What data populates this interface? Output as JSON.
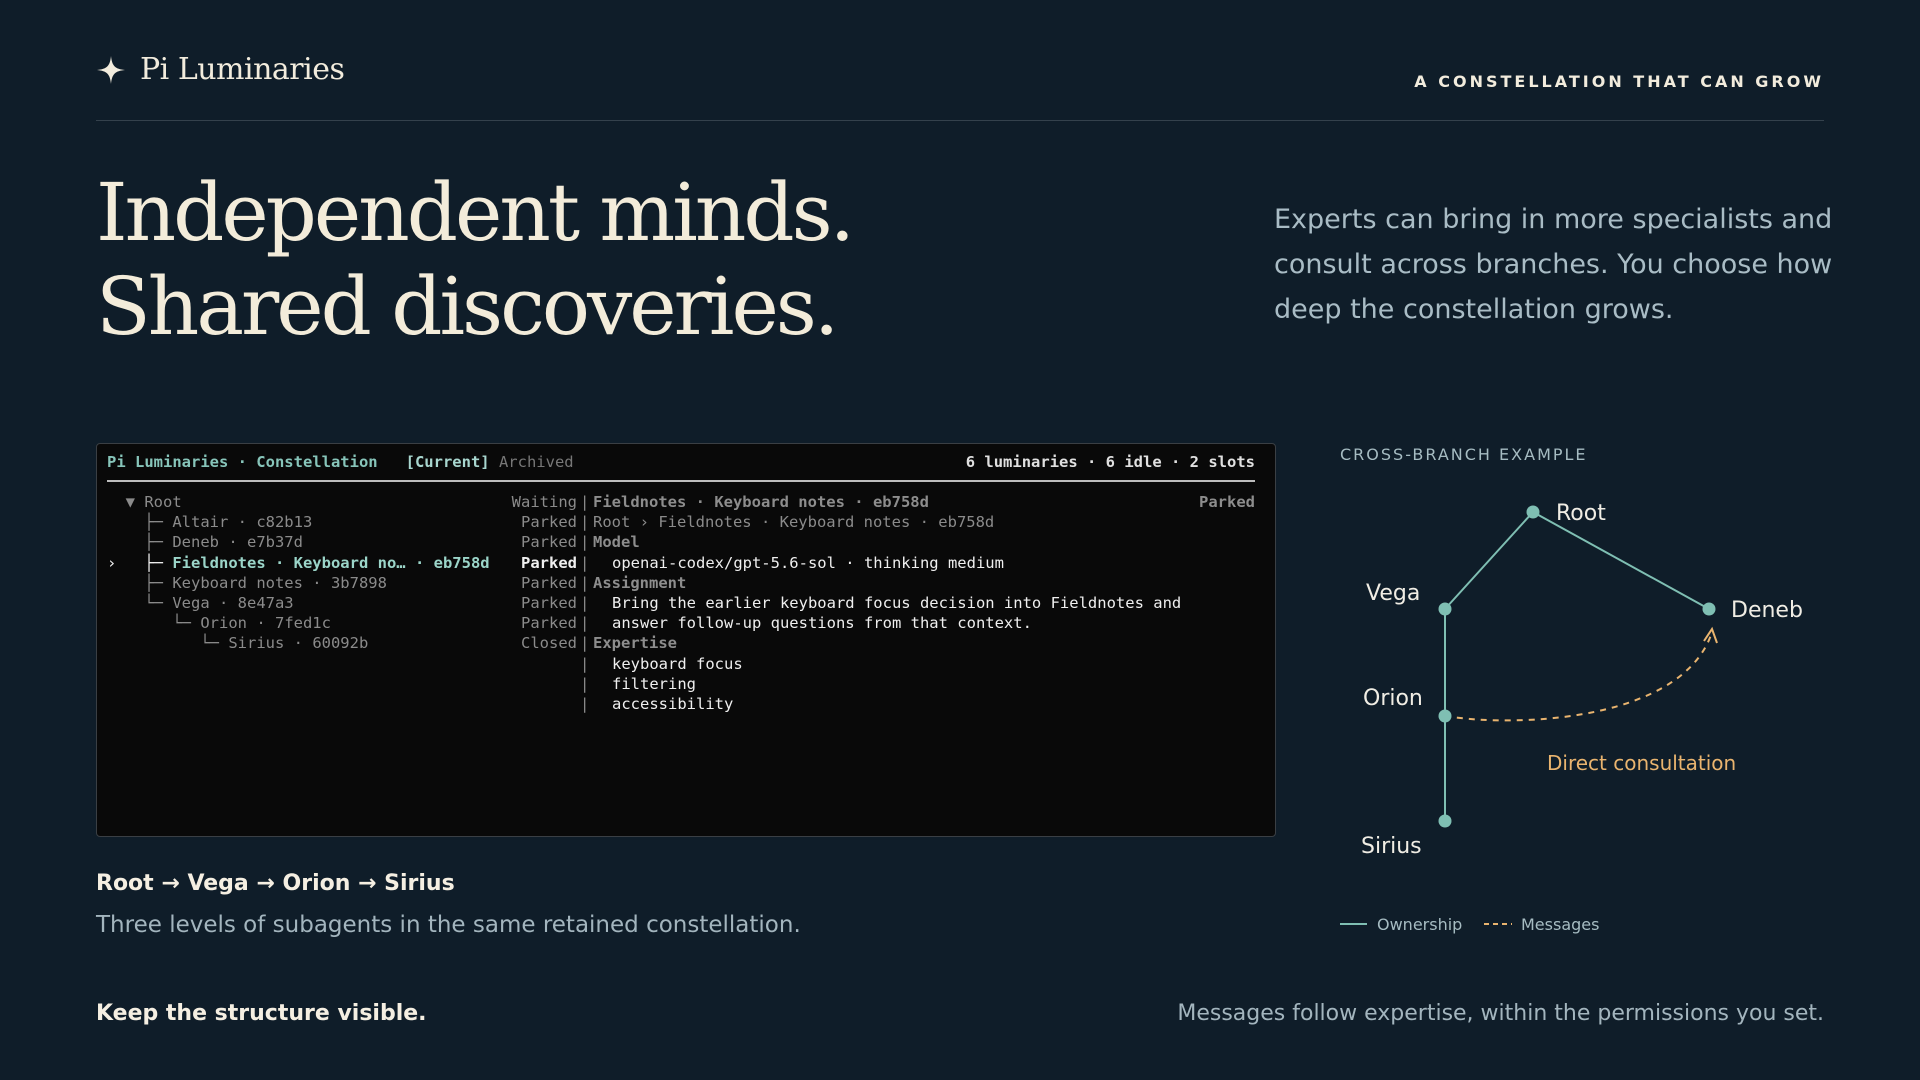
{
  "brand": {
    "icon": "sparkle-icon",
    "name": "Pi Luminaries"
  },
  "tagline": "A CONSTELLATION THAT CAN GROW",
  "hero": {
    "line1": "Independent minds.",
    "line2": "Shared discoveries."
  },
  "intro": "Experts can bring in more specialists and consult across branches. You choose how deep the constellation grows.",
  "terminal": {
    "title": "Pi Luminaries · Constellation",
    "tab_current": "[Current]",
    "tab_archived": "Archived",
    "stats": "6 luminaries · 6 idle · 2 slots",
    "tree": [
      {
        "prefix": "  ▼ ",
        "name": "Root",
        "status": "Waiting"
      },
      {
        "prefix": "    ├─ ",
        "name": "Altair · c82b13",
        "status": "Parked"
      },
      {
        "prefix": "    ├─ ",
        "name": "Deneb · e7b37d",
        "status": "Parked"
      },
      {
        "prefix": "›   ├─ ",
        "name": "Fieldnotes · Keyboard no… · eb758d",
        "status": "Parked"
      },
      {
        "prefix": "    ├─ ",
        "name": "Keyboard notes · 3b7898",
        "status": "Parked"
      },
      {
        "prefix": "    └─ ",
        "name": "Vega · 8e47a3",
        "status": "Parked"
      },
      {
        "prefix": "       └─ ",
        "name": "Orion · 7fed1c",
        "status": "Parked"
      },
      {
        "prefix": "          └─ ",
        "name": "Sirius · 60092b",
        "status": "Closed"
      }
    ],
    "details": {
      "header": "Fieldnotes · Keyboard notes · eb758d",
      "state": "Parked",
      "path": "Root › Fieldnotes · Keyboard notes · eb758d",
      "model_heading": "Model",
      "model": "openai-codex/gpt-5.6-sol · thinking medium",
      "assignment_heading": "Assignment",
      "assignment_line1": "Bring the earlier keyboard focus decision into Fieldnotes and",
      "assignment_line2": "answer follow-up questions from that context.",
      "expertise_heading": "Expertise",
      "expertise": [
        "keyboard focus",
        "filtering",
        "accessibility"
      ]
    }
  },
  "caption": {
    "path": "Root → Vega → Orion → Sirius",
    "description": "Three levels of subagents in the same retained constellation."
  },
  "diagram": {
    "label": "CROSS-BRANCH EXAMPLE",
    "nodes": {
      "root": "Root",
      "vega": "Vega",
      "deneb": "Deneb",
      "orion": "Orion",
      "sirius": "Sirius"
    },
    "consultation": "Direct consultation",
    "legend": {
      "ownership": "Ownership",
      "messages": "Messages"
    },
    "colors": {
      "ownership": "#7fbfb3",
      "messages": "#e9b46f"
    }
  },
  "footer": {
    "left": "Keep the structure visible.",
    "right": "Messages follow expertise, within the permissions you set."
  }
}
